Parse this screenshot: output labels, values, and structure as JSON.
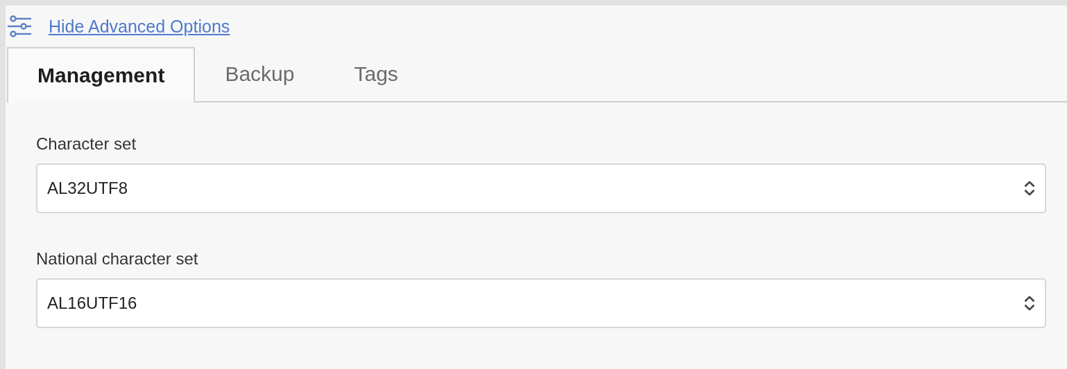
{
  "toggle_link": {
    "label": "Hide Advanced Options"
  },
  "tabs": [
    {
      "label": "Management",
      "selected": true
    },
    {
      "label": "Backup",
      "selected": false
    },
    {
      "label": "Tags",
      "selected": false
    }
  ],
  "fields": [
    {
      "label": "Character set",
      "value": "AL32UTF8"
    },
    {
      "label": "National character set",
      "value": "AL16UTF16"
    }
  ]
}
